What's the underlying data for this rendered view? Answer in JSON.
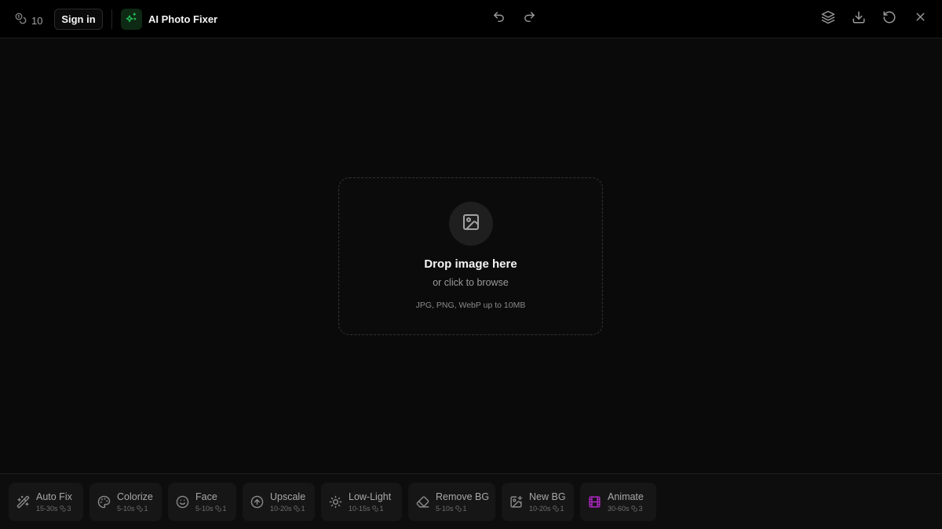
{
  "header": {
    "credits": "10",
    "sign_in_label": "Sign in",
    "app_title": "AI Photo Fixer",
    "accent_color": "#22c55e"
  },
  "dropzone": {
    "title": "Drop image here",
    "subtitle": "or click to browse",
    "hint": "JPG, PNG, WebP up to 10MB"
  },
  "tools": [
    {
      "name": "Auto Fix",
      "time": "15-30s",
      "cost": "3",
      "icon": "magic-wand-icon"
    },
    {
      "name": "Colorize",
      "time": "5-10s",
      "cost": "1",
      "icon": "palette-icon"
    },
    {
      "name": "Face",
      "time": "5-10s",
      "cost": "1",
      "icon": "smile-icon"
    },
    {
      "name": "Upscale",
      "time": "10-20s",
      "cost": "1",
      "icon": "arrow-up-circle-icon"
    },
    {
      "name": "Low-Light",
      "time": "10-15s",
      "cost": "1",
      "icon": "sun-icon"
    },
    {
      "name": "Remove BG",
      "time": "5-10s",
      "cost": "1",
      "icon": "eraser-icon"
    },
    {
      "name": "New BG",
      "time": "10-20s",
      "cost": "1",
      "icon": "image-plus-icon"
    },
    {
      "name": "Animate",
      "time": "30-60s",
      "cost": "3",
      "icon": "film-icon",
      "accent": "#c026d3"
    }
  ]
}
